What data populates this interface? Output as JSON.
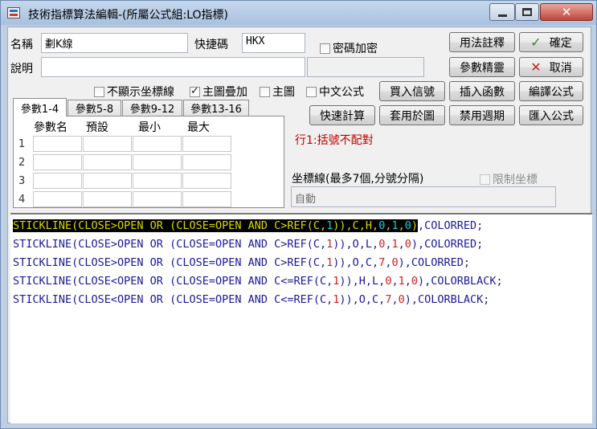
{
  "window": {
    "title": "技術指標算法編輯-(所屬公式組:LO指標)"
  },
  "form": {
    "name_label": "名稱",
    "name_value": "劃K線",
    "shortcut_label": "快捷碼",
    "shortcut_value": "HKX",
    "password_label": "密碼加密",
    "password_checked": false,
    "desc_label": "說明",
    "desc_value": "",
    "desc_extra_value": ""
  },
  "options": {
    "hide_axis_label": "不顯示坐標線",
    "hide_axis_checked": false,
    "main_overlay_label": "主圖疊加",
    "main_overlay_checked": true,
    "main_chart_label": "主圖",
    "main_chart_checked": false,
    "chinese_formula_label": "中文公式",
    "chinese_formula_checked": false
  },
  "buttons": {
    "usage_notes": "用法註釋",
    "confirm": "確定",
    "param_wizard": "參數精靈",
    "cancel": "取消",
    "import_signal": "買入信號",
    "insert_function": "插入函數",
    "compile_formula": "編譯公式",
    "quick_calc": "快速計算",
    "apply_to_chart": "套用於圖",
    "disable_period": "禁用週期",
    "import_formula": "匯入公式"
  },
  "params": {
    "tabs": [
      "參數1-4",
      "參數5-8",
      "參數9-12",
      "參數13-16"
    ],
    "active_tab": 0,
    "columns": [
      "參數名",
      "預設",
      "最小",
      "最大"
    ],
    "rows": [
      "1",
      "2",
      "3",
      "4"
    ]
  },
  "status": {
    "error_message": "行1:括號不配對"
  },
  "axis": {
    "label": "坐標線(最多7個,分號分隔)",
    "limit_label": "限制坐標",
    "limit_checked": false,
    "value": "自動"
  },
  "code": {
    "lines": [
      "STICKLINE(CLOSE>OPEN OR (CLOSE=OPEN AND C>REF(C,1)),C,H,0,1,0),COLORRED;",
      "STICKLINE(CLOSE>OPEN OR (CLOSE=OPEN AND C>REF(C,1)),O,L,0,1,0),COLORRED;",
      "STICKLINE(CLOSE>OPEN OR (CLOSE=OPEN AND C>REF(C,1)),O,C,7,0),COLORRED;",
      "STICKLINE(CLOSE<OPEN OR (CLOSE=OPEN AND C<=REF(C,1)),H,L,0,1,0),COLORBLACK;",
      "STICKLINE(CLOSE<OPEN OR (CLOSE=OPEN AND C<=REF(C,1)),O,C,7,0),COLORBLACK;"
    ],
    "highlighted_line": 0,
    "colors": {
      "keyword": "#1a1a9a",
      "number": "#d42020",
      "highlight_text": "#d8d800",
      "highlight_number": "#10d0d0"
    }
  }
}
